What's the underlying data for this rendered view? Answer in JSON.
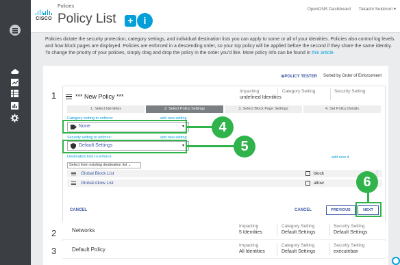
{
  "header": {
    "section": "Policies",
    "title": "Policy List",
    "add_icon": "+",
    "info_icon": "i",
    "links": [
      "OpenDNS Dashboard",
      "Takashi Sekimori ▾"
    ],
    "logo_text": "CISCO"
  },
  "intro": {
    "text": "Policies dictate the security protection, category settings, and individual destination lists you can apply to some or all of your identities.  Policies also control log levels and how block pages are displayed. Policies are enforced in a descending order, so your top policy will be applied before the second if they share the same identity. To change the priority of your policies, simply drag and drop the policy in the order you'd like.  More policy info can be found in ",
    "link": "this article."
  },
  "toolbar": {
    "tester": "⊕POLICY TESTER",
    "sort": "Sorted by Order of Enforcement"
  },
  "policy1": {
    "num": "1",
    "name": "*** New Policy ***",
    "impacting_label": "Impacting",
    "impacting_value": "undefined Identities",
    "category_label": "Category Setting",
    "security_label": "Security Setting",
    "steps": [
      "1. Select Identities",
      "2. Select Policy Settings",
      "3. Select Block Page Settings",
      "4. Set Policy Details"
    ],
    "category_field_label": "Category setting to enforce:",
    "category_add": "add new setting",
    "category_value": "None",
    "security_field_label": "Security setting to enforce:",
    "security_add": "add new setting",
    "security_value": "Default Settings",
    "dest_label": "Destination lists to enforce:",
    "dest_add": "add new d",
    "dest_select": "Select from existing destination list ⌄",
    "lists": [
      {
        "name": "Global Block List",
        "action": "block"
      },
      {
        "name": "Global Allow List",
        "action": "allow"
      }
    ],
    "cancel_left": "CANCEL",
    "cancel_right": "CANCEL",
    "previous": "PREVIOUS",
    "next": "NEXT",
    "caret": "▾"
  },
  "callouts": [
    "4",
    "5",
    "6"
  ],
  "policy2": {
    "num": "2",
    "name": "Networks",
    "impacting_label": "Impacting",
    "impacting_value": "5 Identities",
    "category_label": "Category Setting",
    "category_value": "Default Settings",
    "security_label": "Security Setting",
    "security_value": "Default Settings"
  },
  "policy3": {
    "num": "3",
    "name": "Default Policy",
    "impacting_label": "Impacting",
    "impacting_value": "All Identities",
    "category_label": "Category Setting",
    "category_value": "Default Settings",
    "security_label": "Security Setting",
    "security_value": "executeban"
  },
  "colors": {
    "accent": "#049fd9",
    "callout": "#2fb34a",
    "sidebar": "#3b3f44",
    "link": "#3a56a4"
  },
  "icons": [
    "menu-icon",
    "cloud-icon",
    "report-icon",
    "table-icon",
    "chart-icon",
    "gear-icon",
    "tag-icon",
    "shield-icon",
    "list-icon",
    "edit-checkbox-icon"
  ]
}
